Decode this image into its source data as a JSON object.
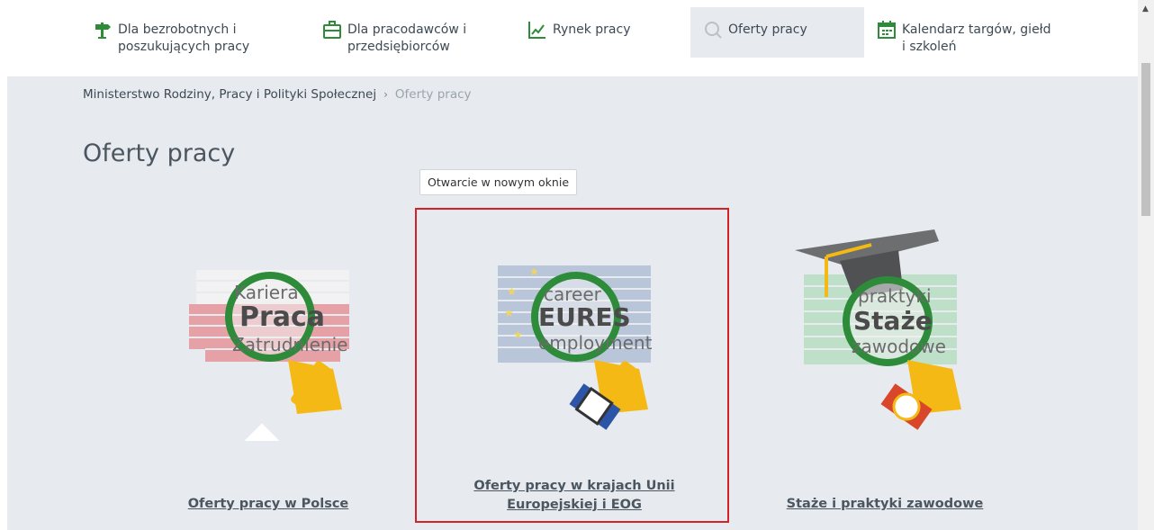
{
  "nav": {
    "items": [
      {
        "label_line1": "Dla bezrobotnych i",
        "label_line2": "poszukujących pracy",
        "icon": "signpost-icon"
      },
      {
        "label_line1": "Dla pracodawców i",
        "label_line2": "przedsiębiorców",
        "icon": "briefcase-icon"
      },
      {
        "label_line1": "Rynek pracy",
        "label_line2": "",
        "icon": "chart-icon"
      },
      {
        "label_line1": "Oferty pracy",
        "label_line2": "",
        "icon": "search-icon"
      },
      {
        "label_line1": "Kalendarz targów, giełd",
        "label_line2": "i szkoleń",
        "icon": "calendar-icon"
      }
    ],
    "active_index": 3
  },
  "breadcrumb": {
    "parent": "Ministerstwo Rodziny, Pracy i Polityki Społecznej",
    "separator": "›",
    "current": "Oferty pracy"
  },
  "page": {
    "title": "Oferty pracy"
  },
  "tooltip": {
    "text": "Otwarcie w nowym oknie"
  },
  "cards": [
    {
      "title": "Oferty pracy w Polsce",
      "badge_word": "Praca",
      "top_word": "Kariera",
      "bottom_word": "Zatrudnienie",
      "wall": "polish-flag-wall",
      "lens_icon": "magnifier-icon"
    },
    {
      "title_line1": "Oferty pracy w krajach Unii",
      "title_line2": "Europejskiej i EOG",
      "badge_word": "EURES",
      "top_word": "career",
      "bottom_word": "employment",
      "wall": "eu-flag-wall",
      "lens_icon": "magnifier-icon"
    },
    {
      "title": "Staże i praktyki zawodowe",
      "badge_word": "Staże",
      "top_word": "praktyki",
      "bottom_word": "zawodowe",
      "wall": "green-wall",
      "lens_icon": "magnifier-icon"
    }
  ],
  "colors": {
    "accent_green": "#2e8b3a",
    "background": "#e7eaee",
    "highlight_border": "#d32228",
    "hand": "#f5b915"
  }
}
